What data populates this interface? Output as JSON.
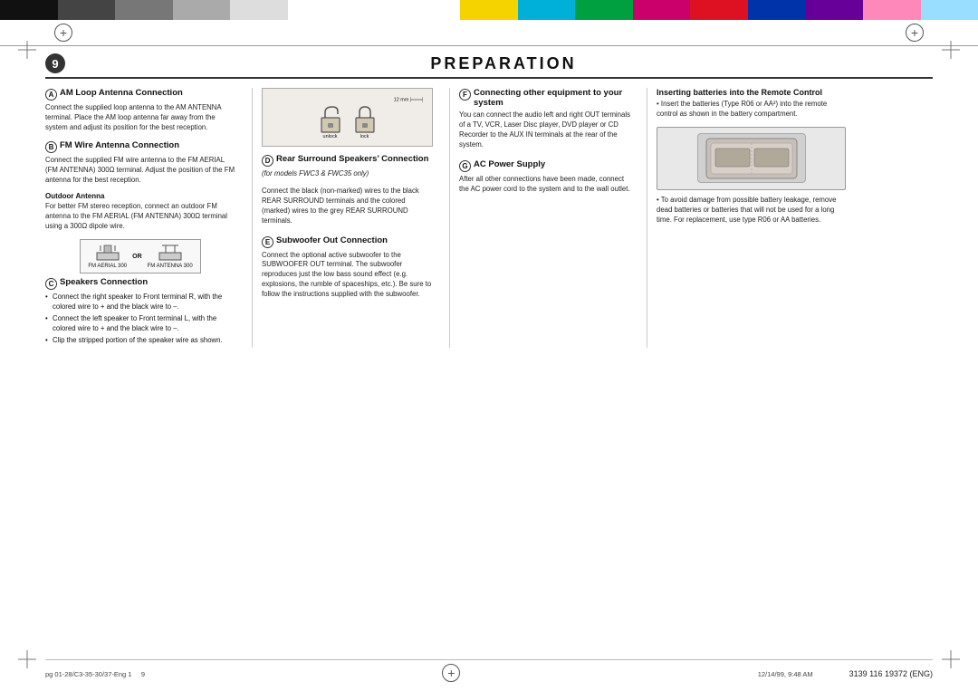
{
  "colorBar": {
    "colors": [
      "black",
      "darkgray",
      "gray",
      "lightgray",
      "white",
      "spacer",
      "yellow",
      "cyan",
      "green",
      "magenta",
      "red",
      "blue",
      "purple",
      "pink",
      "lightblue"
    ]
  },
  "page": {
    "number": "9",
    "title": "PREPARATION"
  },
  "sections": {
    "A": {
      "letter": "A",
      "heading": "AM Loop Antenna Connection",
      "body": "Connect the supplied loop antenna to the AM ANTENNA terminal. Place the AM loop antenna far away from the system and adjust its position for the best reception."
    },
    "B": {
      "letter": "B",
      "heading": "FM Wire Antenna Connection",
      "subheading": "Outdoor Antenna",
      "sub_body": "For better FM stereo reception, connect an outdoor FM antenna to the FM AERIAL (FM ANTENNA) 300Ω terminal using a 300Ω dipole wire.",
      "body": "Connect the supplied FM wire antenna to the FM AERIAL (FM ANTENNA) 300Ω terminal. Adjust the position of the FM antenna for the best reception.",
      "antenna_label1": "FM AERIAL 300",
      "antenna_or": "OR",
      "antenna_label2": "FM ANTENNA 300"
    },
    "C": {
      "letter": "C",
      "heading": "Speakers Connection",
      "bullets": [
        "Connect the right speaker to Front terminal R, with the colored wire to + and the black wire to –.",
        "Connect the left speaker to Front terminal L, with the colored wire to + and the black wire to –.",
        "Clip the stripped portion of the speaker wire as shown."
      ]
    },
    "diagram": {
      "unlock_label": "unlock",
      "lock_label": "lock",
      "dim_label": "12 mm"
    },
    "D": {
      "letter": "D",
      "heading": "Rear Surround Speakers’ Connection",
      "italic": "(for models FWC3 & FWC35 only)",
      "body": "Connect the black (non-marked) wires to the black REAR SURROUND terminals and the colored (marked) wires to the grey REAR SURROUND terminals."
    },
    "E": {
      "letter": "E",
      "heading": "Subwoofer Out Connection",
      "body": "Connect the optional active subwoofer to the SUBWOOFER OUT terminal. The subwoofer reproduces just the low bass sound effect (e.g. explosions, the rumble of spaceships, etc.). Be sure to follow the instructions supplied with the subwoofer."
    },
    "F": {
      "letter": "F",
      "heading": "Connecting other equipment to your system",
      "body": "You can connect the audio left and right OUT terminals of a TV, VCR, Laser Disc player, DVD player or CD Recorder to the AUX IN terminals at the rear of the system."
    },
    "G": {
      "letter": "G",
      "heading": "AC Power Supply",
      "body": "After all other connections have been made, connect the AC power cord to the system and to the wall outlet."
    },
    "remote": {
      "heading": "Inserting batteries into the Remote Control",
      "body1": "Insert the batteries (Type R06 or AA²) into the remote control as shown in the battery compartment.",
      "body2": "To avoid damage from possible battery leakage, remove dead batteries or batteries that will not be used for a long time. For replacement, use type R06 or AA batteries."
    }
  },
  "footer": {
    "left": "pg 01-28/C3-35-30/37-Eng 1",
    "center_page": "9",
    "timestamp": "12/14/99, 9:48 AM",
    "product_code": "3139 116 19372 (ENG)"
  }
}
